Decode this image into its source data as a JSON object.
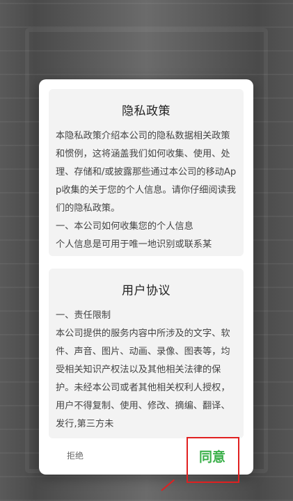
{
  "privacy_policy": {
    "title": "隐私政策",
    "lines": [
      "本隐私政策介绍本公司的隐私数据相关政策和惯例，这将涵盖我们如何收集、使用、处理、存储和/或披露那些通过本公司的移动App收集的关于您的个人信息。请你仔细阅读我们的隐私政策。",
      " 一、本公司如何收集您的个人信息",
      " 个人信息是可用于唯一地识别或联系某"
    ]
  },
  "user_agreement": {
    "title": "用户协议",
    "lines": [
      "一、责任限制",
      " 本公司提供的服务内容中所涉及的文字、软件、声音、图片、动画、录像、图表等，均受相关知识产权法以及其他相关法律的保护。未经本公司或者其他相关权利人授权，用户不得复制、使用、修改、摘编、翻译、发行,第三方未"
    ]
  },
  "actions": {
    "reject_label": "拒绝",
    "agree_label": "同意"
  },
  "colors": {
    "agree": "#3bb04a",
    "highlight": "#e02020"
  }
}
